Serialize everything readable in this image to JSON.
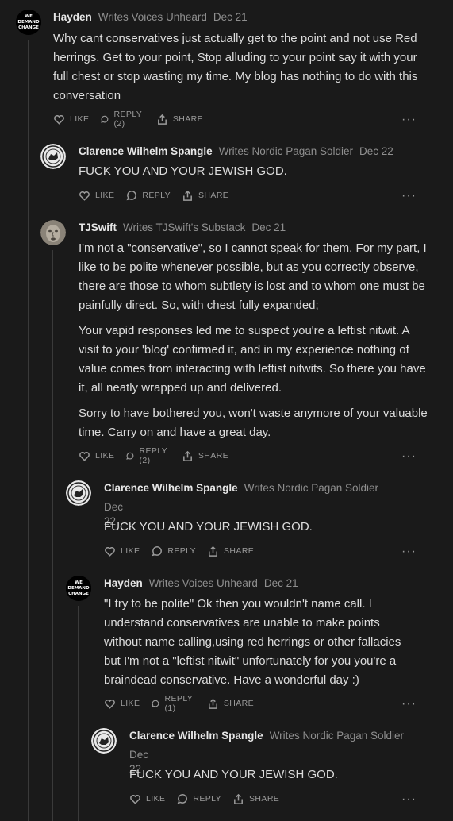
{
  "comments": [
    {
      "author": "Hayden",
      "writes": "Writes Voices Unheard",
      "date": "Dec 21",
      "avatar_text": [
        "WE",
        "DEMAND",
        "CHANGE"
      ],
      "paragraphs": [
        "Why cant conservatives just actually get to the point and not use Red herrings. Get to your point, Stop alluding to your point say it with your full chest or stop wasting my time. My blog has nothing to do with this conversation"
      ],
      "actions": {
        "like": "LIKE",
        "reply": "REPLY (2)",
        "share": "SHARE"
      }
    },
    {
      "author": "Clarence Wilhelm Spangle",
      "writes": "Writes Nordic Pagan Soldier",
      "date": "Dec 22",
      "paragraphs": [
        "FUCK YOU AND YOUR JEWISH GOD."
      ],
      "actions": {
        "like": "LIKE",
        "reply": "REPLY",
        "share": "SHARE"
      }
    },
    {
      "author": "TJSwift",
      "writes": "Writes TJSwift's Substack",
      "date": "Dec 21",
      "paragraphs": [
        "I'm not a \"conservative\", so I cannot speak for them. For my part, I like to be polite whenever possible, but as you correctly observe, there are those to whom subtlety is lost and to whom one must be painfully direct. So, with chest fully expanded;",
        "Your vapid responses led me to suspect you're a leftist nitwit. A visit to your 'blog' confirmed it, and in my experience nothing of value comes from interacting with leftist nitwits. So there you have it, all neatly wrapped up and delivered.",
        "Sorry to have bothered you, won't waste anymore of your valuable time. Carry on and have a great day."
      ],
      "actions": {
        "like": "LIKE",
        "reply": "REPLY (2)",
        "share": "SHARE"
      }
    },
    {
      "author": "Clarence Wilhelm Spangle",
      "writes": "Writes Nordic Pagan Soldier",
      "date": "Dec 22",
      "paragraphs": [
        "FUCK YOU AND YOUR JEWISH GOD."
      ],
      "actions": {
        "like": "LIKE",
        "reply": "REPLY",
        "share": "SHARE"
      }
    },
    {
      "author": "Hayden",
      "writes": "Writes Voices Unheard",
      "date": "Dec 21",
      "avatar_text": [
        "WE",
        "DEMAND",
        "CHANGE"
      ],
      "paragraphs": [
        "\"I try to be polite\" Ok then you wouldn't name call. I understand conservatives are unable to make points without name calling,using red herrings or other fallacies but I'm not a \"leftist nitwit\" unfortunately for you you're a braindead conservative. Have a wonderful day :)"
      ],
      "actions": {
        "like": "LIKE",
        "reply": "REPLY (1)",
        "share": "SHARE"
      }
    },
    {
      "author": "Clarence Wilhelm Spangle",
      "writes": "Writes Nordic Pagan Soldier",
      "date": "Dec 22",
      "paragraphs": [
        "FUCK YOU AND YOUR JEWISH GOD."
      ],
      "actions": {
        "like": "LIKE",
        "reply": "REPLY",
        "share": "SHARE"
      }
    }
  ],
  "more_label": "···"
}
